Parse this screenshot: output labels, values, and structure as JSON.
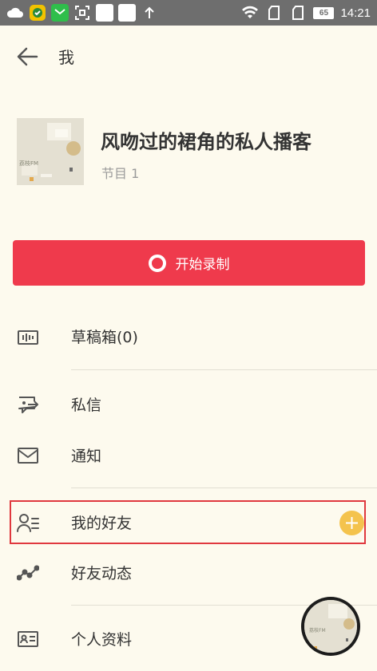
{
  "status_bar": {
    "time": "14:21",
    "battery": "65",
    "icons": [
      "cloud-icon",
      "app-icon",
      "message-icon",
      "scan-icon",
      "notification-icon",
      "notification-icon",
      "upload-arrow-icon",
      "wifi-icon",
      "sim-icon",
      "sim-icon"
    ]
  },
  "header": {
    "back_icon": "arrow-left-icon",
    "title": "我"
  },
  "profile": {
    "avatar_text": "荔枝FM",
    "name": "风吻过的裙角的私人播客",
    "episodes": "节目 1"
  },
  "record": {
    "label": "开始录制",
    "icon": "record-icon"
  },
  "menu": {
    "items": [
      {
        "label": "草稿箱(0)",
        "icon": "draft-box-icon"
      },
      {
        "label": "私信",
        "icon": "private-message-icon"
      },
      {
        "label": "通知",
        "icon": "mail-icon"
      },
      {
        "label": "我的好友",
        "icon": "friends-list-icon"
      },
      {
        "label": "好友动态",
        "icon": "activity-trend-icon"
      },
      {
        "label": "个人资料",
        "icon": "profile-card-icon"
      }
    ]
  },
  "colors": {
    "background": "#fdfaee",
    "accent_red": "#ef3a4c",
    "plus_yellow": "#f4c34d",
    "highlight_border": "#e0383e",
    "status_bar": "#6e6e6e"
  },
  "float_player": {
    "cover_text": "荔枝FM"
  }
}
